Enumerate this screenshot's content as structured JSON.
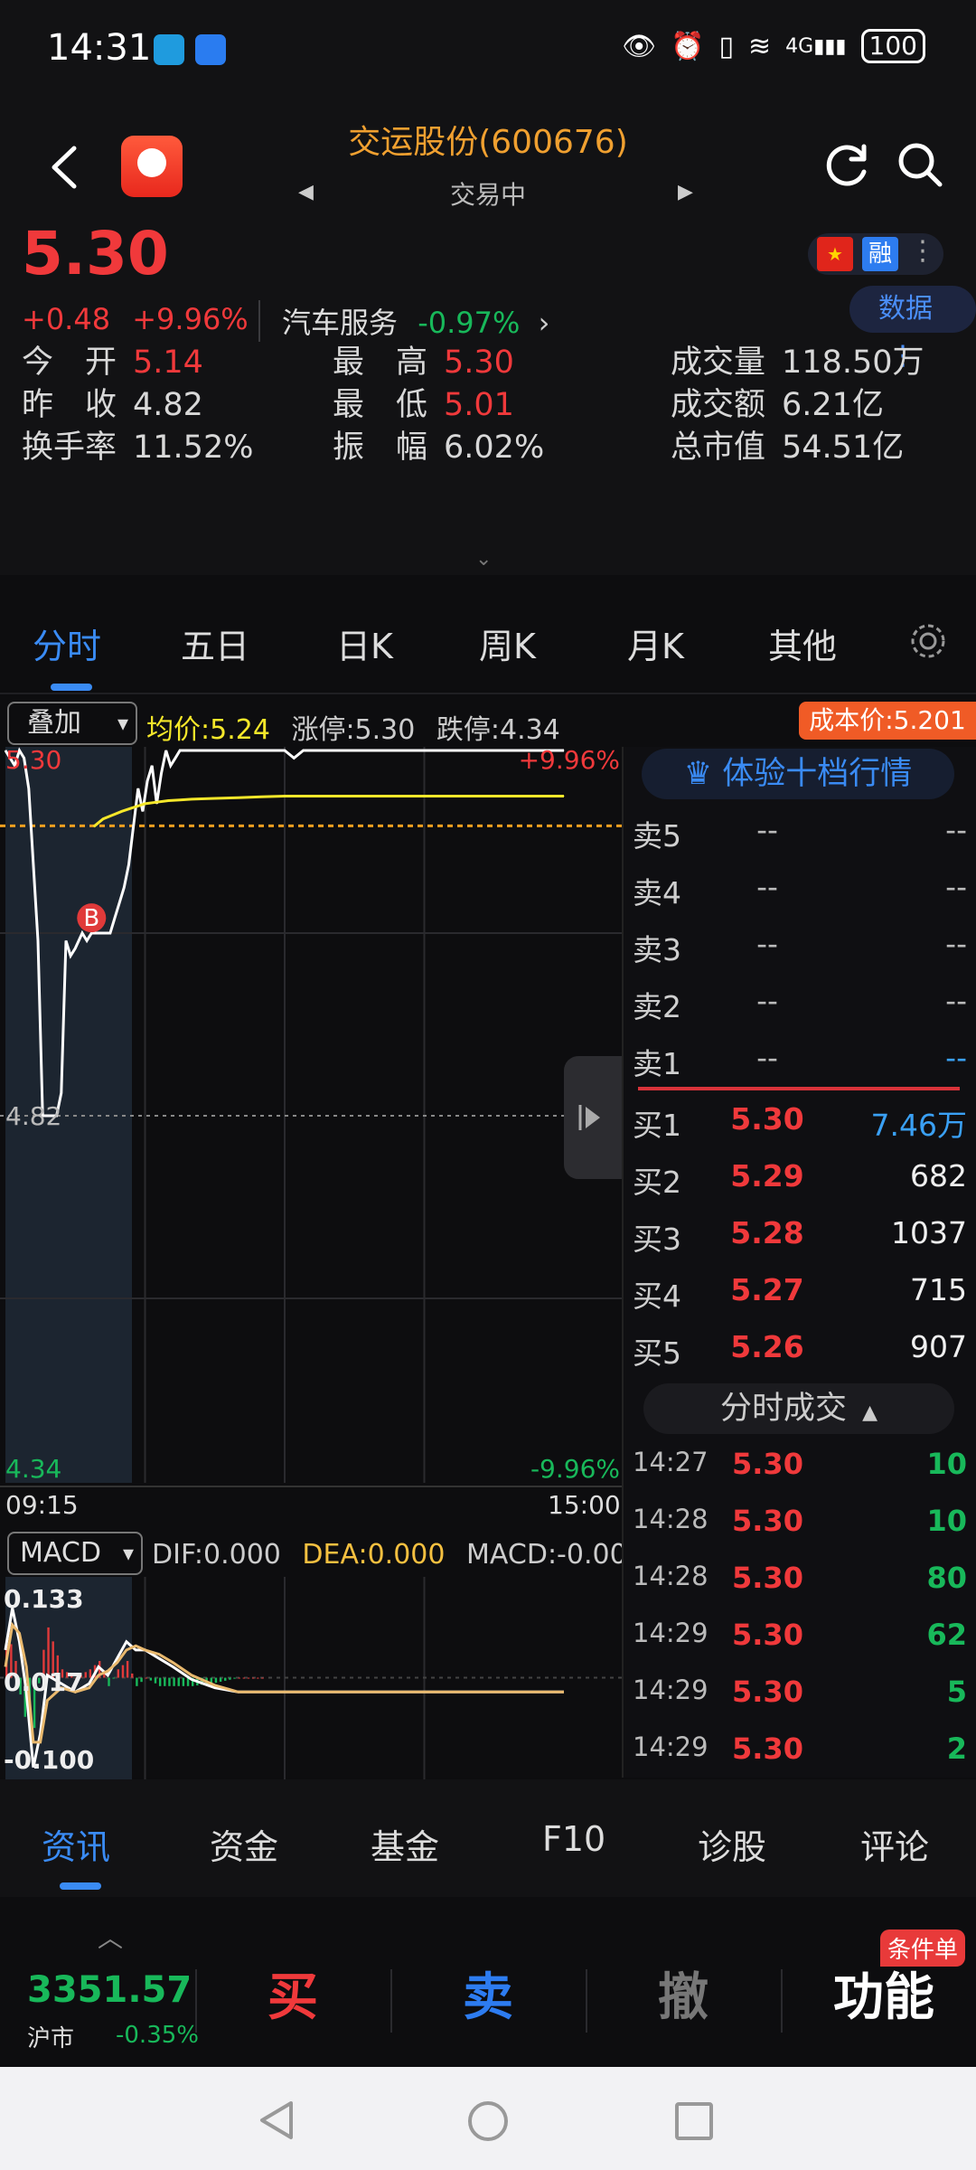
{
  "status_bar": {
    "time": "14:31",
    "battery": "100",
    "network": "4G"
  },
  "header": {
    "title": "交运股份(600676)",
    "status": "交易中"
  },
  "quote": {
    "price": "5.30",
    "change": "+0.48",
    "change_pct": "+9.96%",
    "sector": "汽车服务",
    "sector_pct": "-0.97%",
    "data_label": "数据",
    "rong_label": "融",
    "stats": [
      {
        "label": "今　开",
        "value": "5.14",
        "color": "#f0393b"
      },
      {
        "label": "最　高",
        "value": "5.30",
        "color": "#f0393b"
      },
      {
        "label": "成交量",
        "value": "118.50万",
        "color": "#d8d8d8"
      },
      {
        "label": "昨　收",
        "value": "4.82",
        "color": "#d8d8d8"
      },
      {
        "label": "最　低",
        "value": "5.01",
        "color": "#f0393b"
      },
      {
        "label": "成交额",
        "value": "6.21亿",
        "color": "#d8d8d8"
      },
      {
        "label": "换手率",
        "value": "11.52%",
        "color": "#d8d8d8"
      },
      {
        "label": "振　幅",
        "value": "6.02%",
        "color": "#d8d8d8"
      },
      {
        "label": "总市值",
        "value": "54.51亿",
        "color": "#d8d8d8"
      }
    ]
  },
  "tabs": [
    "分时",
    "五日",
    "日K",
    "周K",
    "月K",
    "其他"
  ],
  "chart_toolbar": {
    "overlay": "叠加",
    "avg_price": "均价:5.24",
    "limit_up": "涨停:5.30",
    "limit_down": "跌停:4.34",
    "cost_price": "成本价:5.201"
  },
  "chart_labels": {
    "top": "5.30",
    "top_pct": "+9.96%",
    "mid": "4.82",
    "bottom": "4.34",
    "bottom_pct": "-9.96%",
    "start_time": "09:15",
    "end_time": "15:00",
    "buy_marker": "B"
  },
  "macd": {
    "label": "MACD",
    "dif": "DIF:0.000",
    "dea": "DEA:0.000",
    "macd": "MACD:-0.00",
    "top": "0.133",
    "mid": "0.017",
    "bottom": "-0.100"
  },
  "chart_data": [
    {
      "type": "line",
      "x_range": [
        "09:15",
        "15:00"
      ],
      "ylim": [
        4.34,
        5.3
      ],
      "series": [
        {
          "name": "",
          "color": "#ffffff",
          "x": [
            0,
            2,
            4,
            6,
            8,
            10,
            12,
            14,
            16,
            18,
            20,
            22,
            24,
            26,
            28,
            30,
            33,
            35,
            37,
            39,
            41,
            43,
            45,
            47,
            49,
            51,
            53,
            55,
            57,
            59,
            61,
            63,
            65,
            67,
            69,
            71,
            73,
            75,
            77,
            80,
            84,
            88,
            92,
            96,
            100,
            104,
            108,
            112,
            116,
            120,
            124,
            128,
            132,
            136,
            140,
            150,
            160,
            170,
            180,
            190,
            200,
            210,
            220,
            230,
            240
          ],
          "y": [
            5.3,
            5.29,
            5.28,
            5.3,
            5.29,
            5.25,
            5.15,
            5.05,
            4.82,
            4.82,
            4.82,
            4.82,
            4.85,
            5.05,
            5.03,
            5.04,
            5.06,
            5.05,
            5.06,
            5.06,
            5.06,
            5.06,
            5.06,
            5.08,
            5.1,
            5.12,
            5.15,
            5.2,
            5.25,
            5.22,
            5.26,
            5.28,
            5.23,
            5.27,
            5.3,
            5.28,
            5.29,
            5.3,
            5.3,
            5.3,
            5.3,
            5.3,
            5.3,
            5.3,
            5.3,
            5.3,
            5.3,
            5.3,
            5.3,
            5.3,
            5.29,
            5.3,
            5.3,
            5.3,
            5.3,
            5.3,
            5.3,
            5.3,
            5.3,
            5.3,
            5.3,
            5.3,
            5.3,
            5.3,
            5.3
          ]
        },
        {
          "name": "",
          "color": "#f5e72a",
          "x": [
            38,
            42,
            46,
            50,
            55,
            60,
            65,
            70,
            75,
            80,
            90,
            100,
            110,
            120,
            130,
            140,
            160,
            180,
            200,
            220,
            240
          ],
          "y": [
            5.2,
            5.21,
            5.215,
            5.22,
            5.225,
            5.23,
            5.232,
            5.234,
            5.235,
            5.236,
            5.237,
            5.238,
            5.239,
            5.24,
            5.24,
            5.24,
            5.24,
            5.24,
            5.24,
            5.24,
            5.24
          ]
        }
      ]
    },
    {
      "type": "line",
      "ylim": [
        -0.1,
        0.133
      ],
      "series": [
        {
          "name": "",
          "color": "#ffffff",
          "x": [
            0,
            3,
            6,
            9,
            12,
            15,
            18,
            24,
            30,
            36,
            40,
            44,
            48,
            52,
            56,
            60,
            66,
            72,
            80,
            90,
            100,
            110,
            240
          ],
          "y": [
            0.05,
            0.1,
            0.06,
            0.0,
            -0.09,
            -0.05,
            0.02,
            0.01,
            0.0,
            0.01,
            0.03,
            0.02,
            0.04,
            0.06,
            0.05,
            0.05,
            0.04,
            0.03,
            0.015,
            0.005,
            0.0,
            0.0,
            0.0
          ]
        },
        {
          "name": "",
          "color": "#e9b96e",
          "x": [
            0,
            3,
            6,
            9,
            12,
            15,
            18,
            24,
            30,
            36,
            40,
            44,
            48,
            52,
            56,
            60,
            66,
            72,
            80,
            90,
            100,
            110,
            240
          ],
          "y": [
            0.03,
            0.08,
            0.07,
            0.03,
            -0.06,
            -0.06,
            -0.01,
            0.005,
            0.0,
            0.005,
            0.02,
            0.025,
            0.035,
            0.05,
            0.055,
            0.05,
            0.045,
            0.035,
            0.02,
            0.008,
            0.0,
            0.0,
            0.0
          ]
        }
      ]
    }
  ],
  "order_book": {
    "title": "体验十档行情",
    "asks": [
      {
        "label": "卖5",
        "price": "--",
        "vol": "--"
      },
      {
        "label": "卖4",
        "price": "--",
        "vol": "--"
      },
      {
        "label": "卖3",
        "price": "--",
        "vol": "--"
      },
      {
        "label": "卖2",
        "price": "--",
        "vol": "--"
      },
      {
        "label": "卖1",
        "price": "--",
        "vol": "--"
      }
    ],
    "bids": [
      {
        "label": "买1",
        "price": "5.30",
        "vol": "7.46万"
      },
      {
        "label": "买2",
        "price": "5.29",
        "vol": "682"
      },
      {
        "label": "买3",
        "price": "5.28",
        "vol": "1037"
      },
      {
        "label": "买4",
        "price": "5.27",
        "vol": "715"
      },
      {
        "label": "买5",
        "price": "5.26",
        "vol": "907"
      }
    ],
    "ticks_title": "分时成交",
    "ticks": [
      {
        "time": "14:27",
        "price": "5.30",
        "vol": "10"
      },
      {
        "time": "14:28",
        "price": "5.30",
        "vol": "10"
      },
      {
        "time": "14:28",
        "price": "5.30",
        "vol": "80"
      },
      {
        "time": "14:29",
        "price": "5.30",
        "vol": "62"
      },
      {
        "time": "14:29",
        "price": "5.30",
        "vol": "5"
      },
      {
        "time": "14:29",
        "price": "5.30",
        "vol": "2"
      }
    ]
  },
  "bottom_tabs": [
    "资讯",
    "资金",
    "基金",
    "F10",
    "诊股",
    "评论"
  ],
  "action_bar": {
    "index_value": "3351.57",
    "index_name": "沪市",
    "index_change": "-0.35%",
    "buy": "买",
    "sell": "卖",
    "cancel": "撤",
    "func": "功能",
    "cond_badge": "条件单"
  }
}
